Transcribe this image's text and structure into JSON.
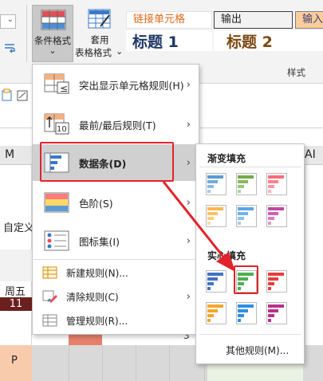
{
  "ribbon": {
    "cond_format_label": "条件格式",
    "cond_format_caret": "⌄",
    "table_format_line1": "套用",
    "table_format_line2": "表格格式",
    "table_format_caret": "⌄",
    "styles": {
      "link_cell": "链接单元格",
      "output": "输出",
      "input": "输入",
      "heading1": "标题 1",
      "heading2": "标题 2"
    },
    "styles_group_caption": "样式"
  },
  "sheet": {
    "col_m": "M",
    "col_ai": "AI",
    "cell_custom": "自定义",
    "cell_friday": "周五",
    "cell_11": "11",
    "cell_p": "P",
    "cell_3": "3"
  },
  "menu": {
    "items": [
      {
        "label": "突出显示单元格规则(H)",
        "icon": "highlight-cells-rules-icon",
        "has_submenu": true
      },
      {
        "label": "最前/最后规则(T)",
        "icon": "top-bottom-rules-icon",
        "has_submenu": true
      },
      {
        "label": "数据条(D)",
        "icon": "data-bars-icon",
        "has_submenu": true,
        "active": true
      },
      {
        "label": "色阶(S)",
        "icon": "color-scales-icon",
        "has_submenu": true
      },
      {
        "label": "图标集(I)",
        "icon": "icon-sets-icon",
        "has_submenu": true
      }
    ],
    "actions": [
      {
        "label": "新建规则(N)...",
        "icon": "new-rule-icon"
      },
      {
        "label": "清除规则(C)",
        "icon": "clear-rules-icon",
        "has_submenu": true
      },
      {
        "label": "管理规则(R)...",
        "icon": "manage-rules-icon"
      }
    ]
  },
  "submenu": {
    "gradient_header": "渐变填充",
    "solid_header": "实心填充",
    "more_rules": "其他规则(M)...",
    "gradient_colors": [
      "#5b9bd5",
      "#70ad47",
      "#ff6b7a",
      "#ffb64d",
      "#58a6e8",
      "#c446a8"
    ],
    "solid_colors": [
      "#4472c4",
      "#4caf50",
      "#e83c3c",
      "#f4a62a",
      "#2f8ee5",
      "#b8318f"
    ]
  },
  "colors": {
    "highlight_red": "#e2232a",
    "menu_active": "#d0d0d0"
  }
}
